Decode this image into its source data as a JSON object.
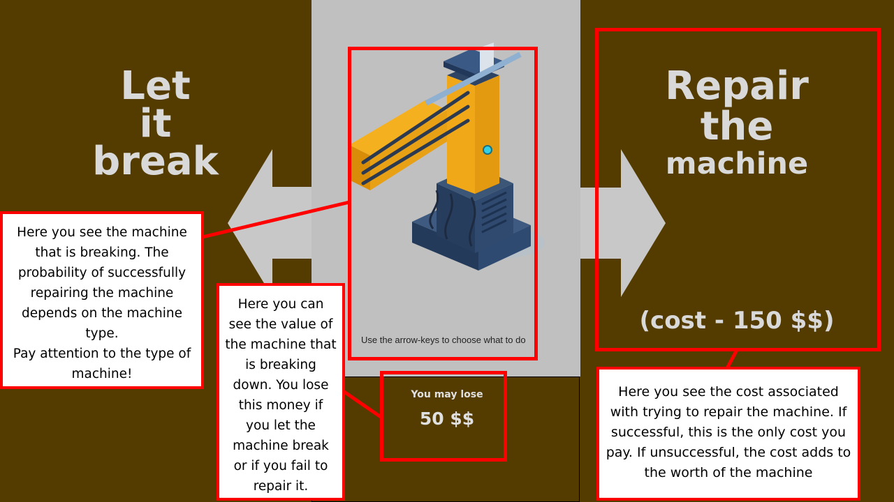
{
  "left_choice": {
    "lines": [
      "Let",
      "it",
      "break"
    ]
  },
  "right_choice": {
    "lines": [
      "Repair",
      "the",
      "machine"
    ],
    "cost_label": "(cost - 150 $$)"
  },
  "hint_text": "Use the arrow-keys to choose what to do",
  "lose_panel": {
    "title": "You may lose",
    "value": "50 $$"
  },
  "callouts": {
    "machine": "Here you see the machine that is breaking. The probability of successfully repairing the machine depends on the machine type.\nPay attention to the type of machine!",
    "value": "Here you can see the value of the machine that is breaking down. You lose this money if you let the machine break or if you fail to repair it.",
    "cost": "Here you see the cost associated with trying to repair the machine. If successful, this is the only cost you pay. If unsuccessful, the cost adds to the worth of the machine"
  },
  "colors": {
    "background": "#543c00",
    "panel": "#c0c0c0",
    "highlight": "#ff0000",
    "label": "#d9d9d9"
  }
}
